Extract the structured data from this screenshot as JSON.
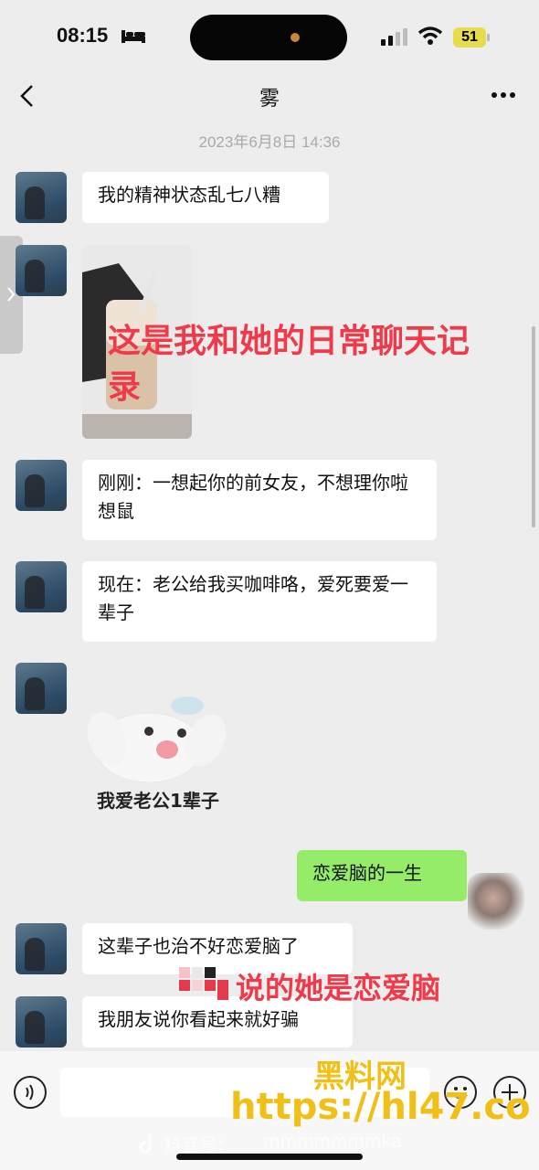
{
  "status_bar": {
    "time": "08:15",
    "battery": "51"
  },
  "header": {
    "title": "雾"
  },
  "chat": {
    "timestamp": "2023年6月8日 14:36",
    "messages": [
      {
        "text": "我的精神状态乱七八糟"
      },
      {
        "text": "刚刚：一想起你的前女友，不想理你啦想鼠"
      },
      {
        "text": "现在：老公给我买咖啡咯，爱死要爱一辈子"
      },
      {
        "sticker_caption": "我爱老公1辈子"
      },
      {
        "text": "恋爱脑的一生"
      },
      {
        "text": "这辈子也治不好恋爱脑了"
      },
      {
        "text": "我朋友说你看起来就好骗"
      }
    ]
  },
  "overlays": {
    "caption_line1": "这是我和她的日常聊天记",
    "caption_line2": "录",
    "bottom_caption": "说的她是恋爱脑"
  },
  "watermark": {
    "site_cn": "黑料网",
    "url": "https://hl47.co",
    "douyin": "抖音号：",
    "douyin_id": "mmmmmmmka"
  },
  "colors": {
    "self_bubble": "#95ec69",
    "overlay_red": "#ee3a4a",
    "watermark": "#f0c018"
  }
}
